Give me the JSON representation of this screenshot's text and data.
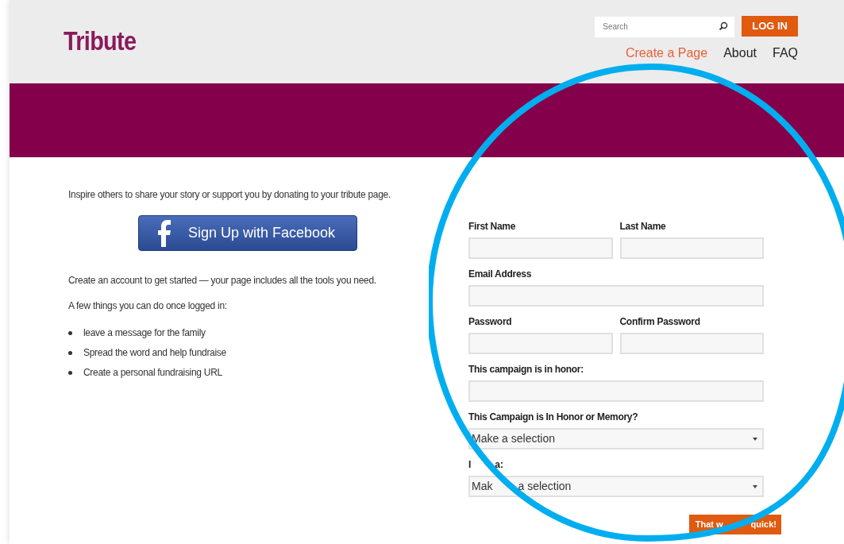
{
  "header": {
    "logo": "Tribute",
    "search": {
      "placeholder": "Search"
    },
    "login_button": "LOG IN",
    "nav": [
      {
        "label": "Create a Page",
        "selected": true
      },
      {
        "label": "About",
        "selected": false
      },
      {
        "label": "FAQ",
        "selected": false
      }
    ]
  },
  "intro": {
    "text": "Inspire others to share your story or support you by donating to your tribute page.",
    "facebook_button": "Sign Up with Facebook",
    "account_text": "Create an account to get started — your page includes all the tools you need.",
    "list_title": "A few things you can do once logged in:",
    "list_items": [
      "leave a message for the family",
      "Spread the word and help fundraise",
      "Create a personal fundraising URL"
    ]
  },
  "form": {
    "rows": [
      [
        {
          "kind": "text",
          "label": "First Name"
        },
        {
          "kind": "text",
          "label": "Last Name"
        }
      ],
      [
        {
          "kind": "text",
          "label": "Email Address"
        }
      ],
      [
        {
          "kind": "text",
          "label": "Password"
        },
        {
          "kind": "text",
          "label": "Confirm Password"
        }
      ],
      [
        {
          "kind": "text",
          "label": "This campaign is in honor:"
        }
      ],
      [
        {
          "kind": "select",
          "label": "This Campaign is In Honor or Memory?",
          "value": "Make a selection"
        }
      ],
      [
        {
          "kind": "select",
          "label_parts": [
            "I",
            "a:"
          ],
          "value_parts": [
            "Mak",
            "a selection"
          ]
        }
      ]
    ],
    "submit_button_parts": [
      "That w",
      "quick!"
    ]
  }
}
